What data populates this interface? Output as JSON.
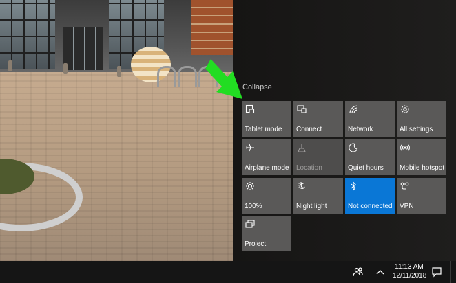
{
  "action_center": {
    "collapse_label": "Collapse",
    "tiles": [
      {
        "label": "Tablet mode",
        "icon": "tablet-mode-icon",
        "state": "off"
      },
      {
        "label": "Connect",
        "icon": "connect-icon",
        "state": "off"
      },
      {
        "label": "Network",
        "icon": "network-icon",
        "state": "off"
      },
      {
        "label": "All settings",
        "icon": "gear-icon",
        "state": "off"
      },
      {
        "label": "Airplane mode",
        "icon": "airplane-icon",
        "state": "off"
      },
      {
        "label": "Location",
        "icon": "location-icon",
        "state": "disabled"
      },
      {
        "label": "Quiet hours",
        "icon": "moon-icon",
        "state": "off"
      },
      {
        "label": "Mobile hotspot",
        "icon": "hotspot-icon",
        "state": "off"
      },
      {
        "label": "100%",
        "icon": "brightness-icon",
        "state": "off"
      },
      {
        "label": "Night light",
        "icon": "night-light-icon",
        "state": "off"
      },
      {
        "label": "Not connected",
        "icon": "bluetooth-icon",
        "state": "active"
      },
      {
        "label": "VPN",
        "icon": "vpn-icon",
        "state": "off"
      },
      {
        "label": "Project",
        "icon": "project-icon",
        "state": "off"
      }
    ]
  },
  "colors": {
    "tile": "#5a5958",
    "tile_active": "#0a77d6",
    "panel": "#1f1e1d",
    "arrow": "#22dd22",
    "taskbar": "#151515"
  },
  "taskbar": {
    "time": "11:13 AM",
    "date": "12/11/2018",
    "icons": [
      "people-icon",
      "chevron-up-icon",
      "notification-icon"
    ]
  }
}
